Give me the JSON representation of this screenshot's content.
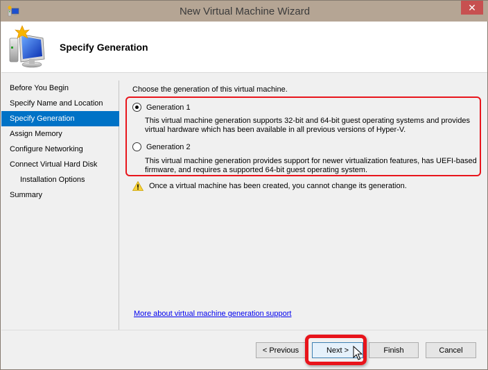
{
  "window": {
    "title": "New Virtual Machine Wizard",
    "close_label": "✕"
  },
  "header": {
    "heading": "Specify Generation"
  },
  "nav": {
    "items": [
      {
        "label": "Before You Begin",
        "active": false,
        "sub": false
      },
      {
        "label": "Specify Name and Location",
        "active": false,
        "sub": false
      },
      {
        "label": "Specify Generation",
        "active": true,
        "sub": false
      },
      {
        "label": "Assign Memory",
        "active": false,
        "sub": false
      },
      {
        "label": "Configure Networking",
        "active": false,
        "sub": false
      },
      {
        "label": "Connect Virtual Hard Disk",
        "active": false,
        "sub": false
      },
      {
        "label": "Installation Options",
        "active": false,
        "sub": true
      },
      {
        "label": "Summary",
        "active": false,
        "sub": false
      }
    ]
  },
  "content": {
    "prompt": "Choose the generation of this virtual machine.",
    "options": [
      {
        "label": "Generation 1",
        "selected": true,
        "description": "This virtual machine generation supports 32-bit and 64-bit guest operating systems and provides virtual hardware which has been available in all previous versions of Hyper-V."
      },
      {
        "label": "Generation 2",
        "selected": false,
        "description": "This virtual machine generation provides support for newer virtualization features, has UEFI-based firmware, and requires a supported 64-bit guest operating system."
      }
    ],
    "warning": "Once a virtual machine has been created, you cannot change its generation.",
    "more_link": "More about virtual machine generation support"
  },
  "footer": {
    "previous_label": "< Previous",
    "next_label": "Next >",
    "finish_label": "Finish",
    "cancel_label": "Cancel"
  },
  "colors": {
    "titlebar": "#b5a594",
    "close": "#c75050",
    "nav_active": "#0072c6",
    "annotation": "#e8141b",
    "link": "#0000ee"
  }
}
